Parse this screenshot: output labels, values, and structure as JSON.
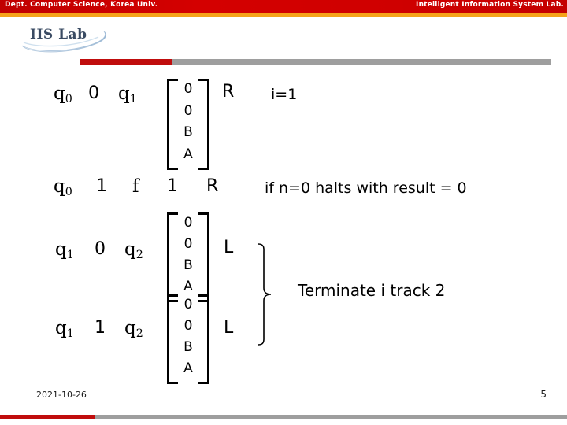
{
  "header": {
    "left_text": "Dept. Computer Science, Korea Univ.",
    "right_text": "Intelligent Information System Lab.",
    "band_red": "#cc0000",
    "band_orange": "#f5a31a"
  },
  "logo": {
    "label": "IIS Lab",
    "icon": "swoosh-icon"
  },
  "divider": {
    "red": "#c00d0d",
    "gray": "#9e9e9e"
  },
  "rules": [
    {
      "state_from": "q",
      "state_from_sub": "0",
      "read": "0",
      "state_to": "q",
      "state_to_sub": "1",
      "write": [
        "0",
        "0",
        "B",
        "A"
      ],
      "move": "R",
      "note": "i=1"
    },
    {
      "state_from": "q",
      "state_from_sub": "0",
      "read": "1",
      "state_to": "f",
      "state_to_sub": "",
      "write": [
        "1"
      ],
      "move": "R",
      "note": "if n=0 halts with result = 0"
    },
    {
      "state_from": "q",
      "state_from_sub": "1",
      "read": "0",
      "state_to": "q",
      "state_to_sub": "2",
      "write": [
        "0",
        "0",
        "B",
        "A"
      ],
      "move": "L",
      "note": ""
    },
    {
      "state_from": "q",
      "state_from_sub": "1",
      "read": "1",
      "state_to": "q",
      "state_to_sub": "2",
      "write": [
        "0",
        "0",
        "B",
        "A"
      ],
      "move": "L",
      "note": ""
    }
  ],
  "brace_note": "Terminate i track 2",
  "footer": {
    "date": "2021-10-26",
    "page": "5",
    "bar_red": "#c00d0d",
    "bar_gray": "#9e9e9e"
  }
}
